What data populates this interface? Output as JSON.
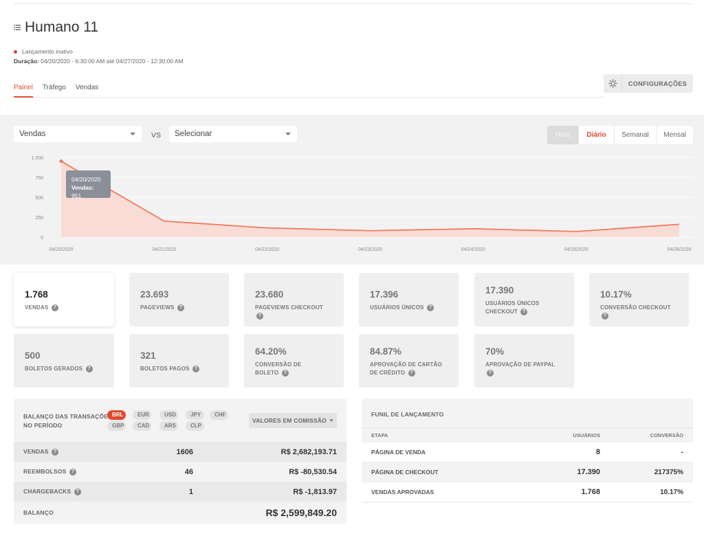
{
  "page": {
    "title": "Humano 11",
    "status": "Lançamento inativo",
    "duration_label": "Duração:",
    "duration_value": "04/20/2020 - 6:30:00 AM até 04/27/2020 - 12:30:00 AM"
  },
  "tabs": [
    {
      "label": "Painel",
      "active": true
    },
    {
      "label": "Tráfego",
      "active": false
    },
    {
      "label": "Vendas",
      "active": false
    }
  ],
  "config_label": "CONFIGURAÇÕES",
  "chart_controls": {
    "metric": "Vendas",
    "vs": "VS",
    "compare": "Selecionar",
    "periods": [
      "Hora",
      "Diário",
      "Semanal",
      "Mensal"
    ],
    "active_period": "Diário",
    "disabled_period": "Hora"
  },
  "tooltip": {
    "date": "04/20/2020",
    "label": "Vendas:",
    "value": "951"
  },
  "chart_data": {
    "type": "area",
    "x": [
      "04/20/2020",
      "04/21/2020",
      "04/22/2020",
      "04/23/2020",
      "04/24/2020",
      "04/25/2020",
      "04/26/2020"
    ],
    "values": [
      951,
      200,
      115,
      80,
      105,
      70,
      160
    ],
    "yticks": [
      "1.000",
      "750",
      "500",
      "250",
      "0"
    ],
    "ylim": [
      0,
      1000
    ],
    "grid": true,
    "color": "#f07b5e",
    "fill": "#f9dcd6"
  },
  "metrics_row1": [
    {
      "value": "1.768",
      "label": "VENDAS",
      "name": "vendas"
    },
    {
      "value": "23.693",
      "label": "PAGEVIEWS",
      "name": "pageviews"
    },
    {
      "value": "23.680",
      "label": "PAGEVIEWS CHECKOUT",
      "name": "pageviews-checkout"
    },
    {
      "value": "17.396",
      "label": "USUÁRIOS ÚNICOS",
      "name": "usuarios-unicos"
    },
    {
      "value": "17.390",
      "label": "USUÁRIOS ÚNICOS CHECKOUT",
      "name": "usuarios-unicos-checkout"
    },
    {
      "value": "10.17%",
      "label": "CONVERSÃO CHECKOUT",
      "name": "conversao-checkout"
    }
  ],
  "metrics_row2": [
    {
      "value": "500",
      "label": "BOLETOS GERADOS",
      "name": "boletos-gerados"
    },
    {
      "value": "321",
      "label": "BOLETOS PAGOS",
      "name": "boletos-pagos"
    },
    {
      "value": "64.20%",
      "label": "CONVERSÃO DE BOLETO",
      "name": "conversao-boleto"
    },
    {
      "value": "84.87%",
      "label": "APROVAÇÃO DE CARTÃO DE CRÉDITO",
      "name": "aprovacao-cartao"
    },
    {
      "value": "70%",
      "label": "APROVAÇÃO DE PAYPAL",
      "name": "aprovacao-paypal"
    }
  ],
  "balance": {
    "title_line1": "BALANÇO DAS TRANSAÇÕES",
    "title_line2": "NO PERÍODO",
    "currencies": [
      "BRL",
      "EUR",
      "USD",
      "JPY",
      "CHF",
      "GBP",
      "CAD",
      "ARS",
      "CLP"
    ],
    "active_currency": "BRL",
    "commission_label": "VALORES EM COMISSÃO",
    "rows": [
      {
        "label": "VENDAS",
        "count": "1606",
        "value": "R$ 2,682,193.71"
      },
      {
        "label": "REEMBOLSOS",
        "count": "46",
        "value": "R$ -80,530.54"
      },
      {
        "label": "CHARGEBACKS",
        "count": "1",
        "value": "R$ -1,813.97"
      }
    ],
    "total_label": "BALANÇO",
    "total_value": "R$ 2,599,849.20"
  },
  "funnel": {
    "title": "FUNIL DE LANÇAMENTO",
    "headers": [
      "ETAPA",
      "USUÁRIOS",
      "CONVERSÃO"
    ],
    "rows": [
      {
        "stage": "PÁGINA DE VENDA",
        "users": "8",
        "conversion": "-"
      },
      {
        "stage": "PÁGINA DE CHECKOUT",
        "users": "17.390",
        "conversion": "217375%"
      },
      {
        "stage": "VENDAS APROVADAS",
        "users": "1.768",
        "conversion": "10.17%"
      }
    ]
  },
  "icons": {
    "title": "list-icon",
    "status": "status-dot-icon",
    "config": "gear-icon",
    "help": "help-circle-icon",
    "dropdown": "caret-down-icon"
  },
  "colors": {
    "accent": "#e2492f",
    "status_inactive": "#e03a3a",
    "panel_bg": "#f2f2f2"
  }
}
